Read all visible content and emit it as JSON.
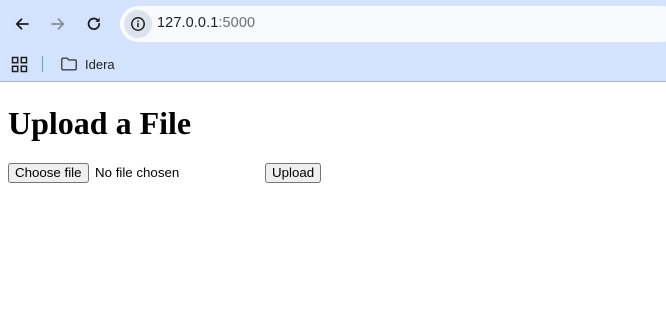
{
  "browser": {
    "url_host": "127.0.0.1",
    "url_port": ":5000",
    "bookmarks": [
      {
        "label": "Idera",
        "icon": "folder-icon"
      }
    ],
    "icons": {
      "back": "arrow-left-icon",
      "forward": "arrow-right-icon",
      "reload": "reload-icon",
      "site_info": "info-icon",
      "apps": "apps-grid-icon"
    }
  },
  "page": {
    "title": "Upload a File",
    "file_input": {
      "button_label": "Choose file",
      "status": "No file chosen"
    },
    "submit_label": "Upload"
  }
}
